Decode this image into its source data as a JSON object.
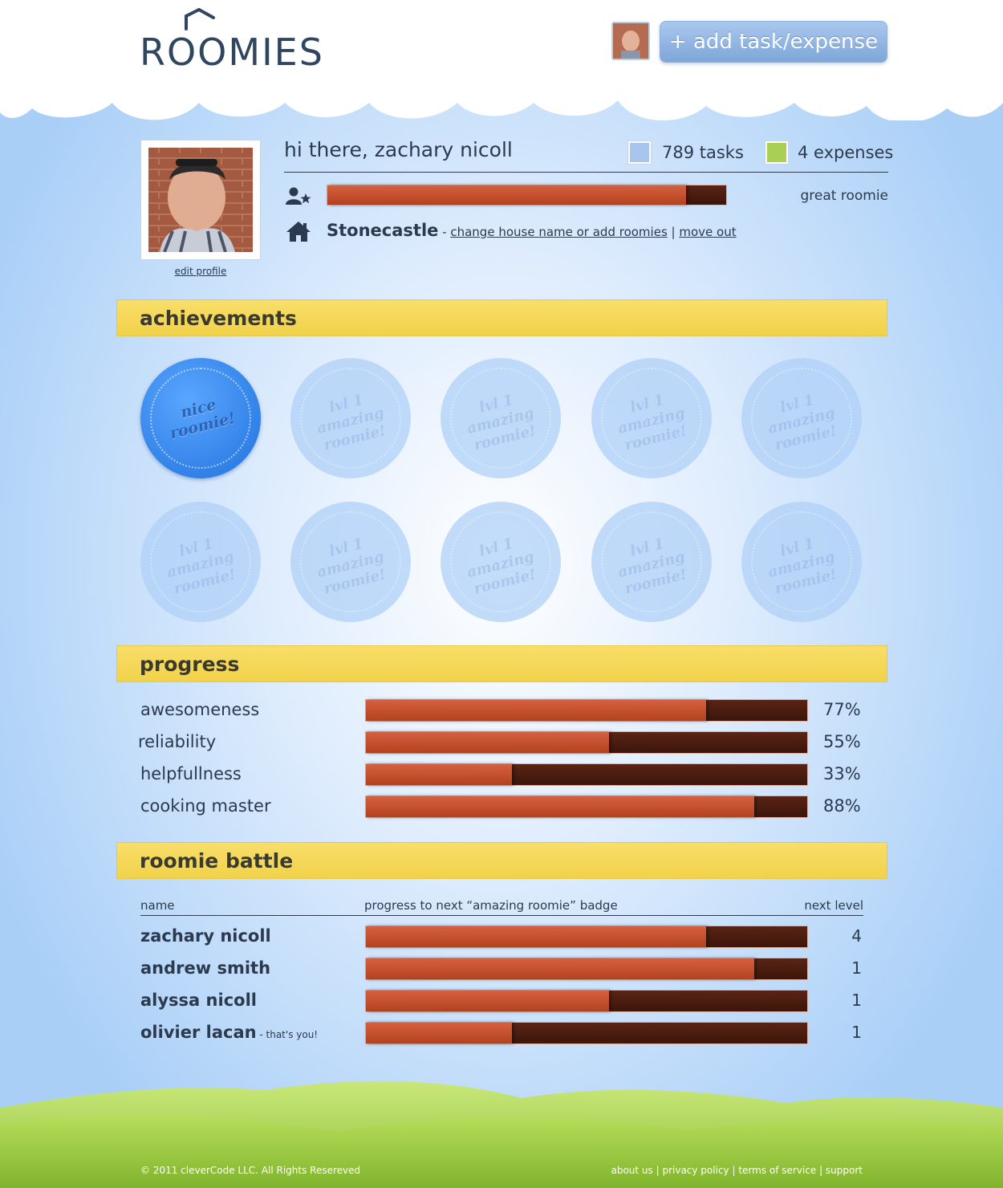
{
  "header": {
    "logo_text": "ROOMIES",
    "add_button_label": "+ add task/expense"
  },
  "profile": {
    "edit_profile_label": "edit profile",
    "greeting": "hi there, zachary nicoll",
    "tasks_label": "789 tasks",
    "expenses_label": "4 expenses",
    "tasks_color": "#a7c6ee",
    "expenses_color": "#a9cf55",
    "roomie_progress": 0.9,
    "rank_label": "great roomie",
    "house_name": "Stonecastle",
    "house_separator": " - ",
    "change_house_link": "change house name or add roomies",
    "link_separator": " | ",
    "move_out_link": "move out"
  },
  "achievements": {
    "title": "achievements",
    "badges": [
      {
        "text_line1": "nice",
        "text_line2": "roomie!",
        "earned": true
      },
      {
        "text_line1": "lvl 1",
        "text_line2": "amazing",
        "text_line3": "roomie!",
        "earned": false
      },
      {
        "text_line1": "lvl 1",
        "text_line2": "amazing",
        "text_line3": "roomie!",
        "earned": false
      },
      {
        "text_line1": "lvl 1",
        "text_line2": "amazing",
        "text_line3": "roomie!",
        "earned": false
      },
      {
        "text_line1": "lvl 1",
        "text_line2": "amazing",
        "text_line3": "roomie!",
        "earned": false
      },
      {
        "text_line1": "lvl 1",
        "text_line2": "amazing",
        "text_line3": "roomie!",
        "earned": false
      },
      {
        "text_line1": "lvl 1",
        "text_line2": "amazing",
        "text_line3": "roomie!",
        "earned": false
      },
      {
        "text_line1": "lvl 1",
        "text_line2": "amazing",
        "text_line3": "roomie!",
        "earned": false
      },
      {
        "text_line1": "lvl 1",
        "text_line2": "amazing",
        "text_line3": "roomie!",
        "earned": false
      },
      {
        "text_line1": "lvl 1",
        "text_line2": "amazing",
        "text_line3": "roomie!",
        "earned": false
      }
    ]
  },
  "progress": {
    "title": "progress",
    "rows": [
      {
        "label": "awesomeness",
        "percent_label": "77%",
        "value": 77
      },
      {
        "label": "reliability",
        "percent_label": "55%",
        "value": 55
      },
      {
        "label": "helpfullness",
        "percent_label": "33%",
        "value": 33
      },
      {
        "label": "cooking master",
        "percent_label": "88%",
        "value": 88
      }
    ]
  },
  "battle": {
    "title": "roomie battle",
    "col_name": "name",
    "col_progress": "progress to next “amazing roomie” badge",
    "col_level": "next level",
    "rows": [
      {
        "name": "zachary nicoll",
        "note": "",
        "value": 77,
        "level": "4"
      },
      {
        "name": "andrew smith",
        "note": "",
        "value": 88,
        "level": "1"
      },
      {
        "name": "alyssa nicoll",
        "note": "",
        "value": 55,
        "level": "1"
      },
      {
        "name": "olivier lacan",
        "note": " - that's you!",
        "value": 33,
        "level": "1"
      }
    ]
  },
  "footer": {
    "copyright": "© 2011 cleverCode LLC. All Rights Resereved",
    "links": [
      "about us",
      "privacy policy",
      "terms of service",
      "support"
    ],
    "link_separator": " | "
  }
}
